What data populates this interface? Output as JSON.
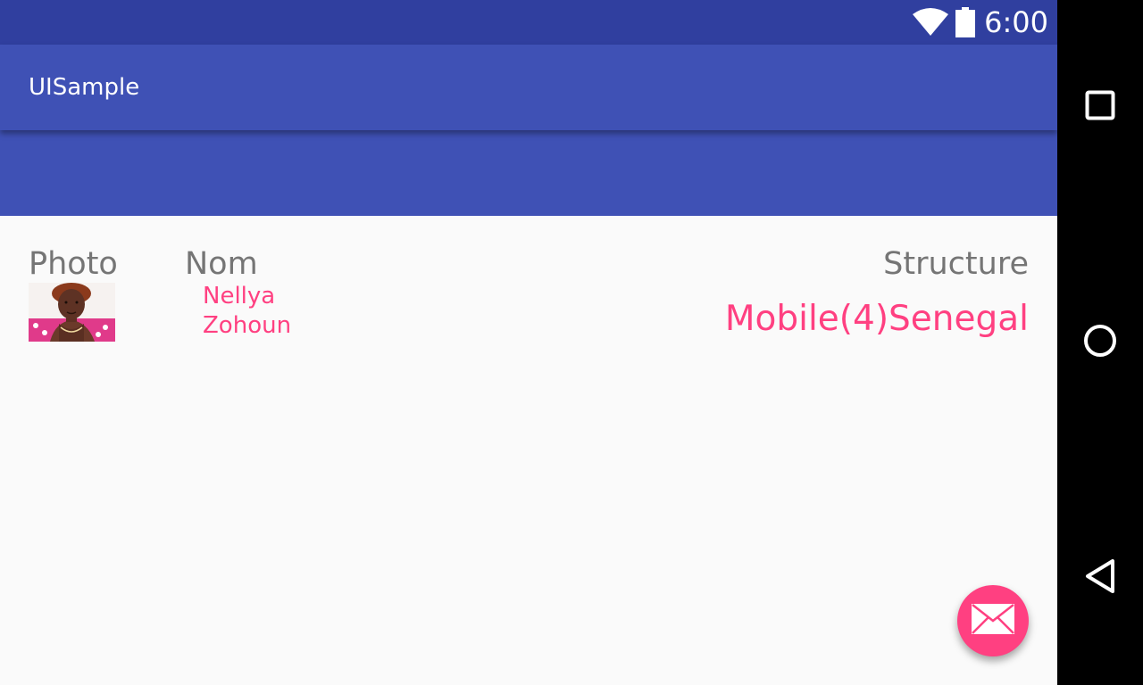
{
  "status_bar": {
    "time": "6:00",
    "wifi_icon": "wifi-icon",
    "battery_icon": "battery-icon"
  },
  "app_bar": {
    "title": "UISample"
  },
  "table": {
    "headers": {
      "photo": "Photo",
      "nom": "Nom",
      "structure": "Structure"
    },
    "row": {
      "photo_icon": "profile-photo",
      "first_name": "Nellya",
      "last_name": "Zohoun",
      "structure": "Mobile(4)Senegal"
    }
  },
  "fab": {
    "icon": "email-icon"
  },
  "nav_bar": {
    "recents_icon": "square-icon",
    "home_icon": "circle-icon",
    "back_icon": "triangle-back-icon"
  },
  "colors": {
    "status_bar": "#303f9f",
    "primary": "#3f51b5",
    "accent": "#ff4081",
    "header_text": "#757575",
    "background": "#fafafa"
  }
}
